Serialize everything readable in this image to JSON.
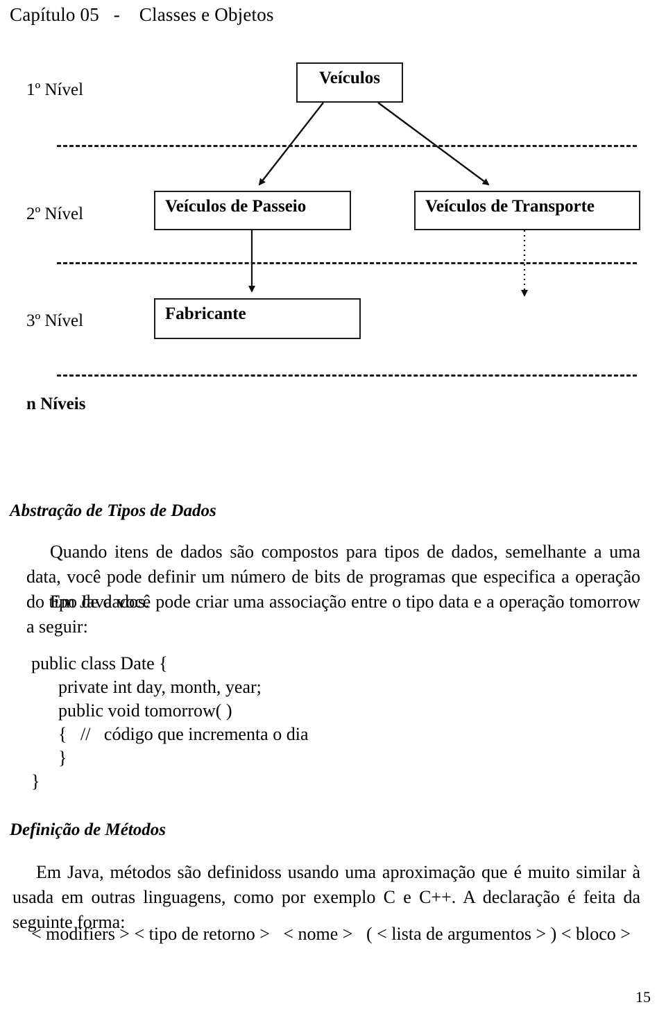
{
  "header": {
    "chapter": "Capítulo 05   -    Classes e Objetos"
  },
  "diagram": {
    "levels": [
      {
        "label": "1º Nível",
        "bold": false
      },
      {
        "label": "2º Nível",
        "bold": false
      },
      {
        "label": "3º Nível",
        "bold": false
      },
      {
        "label": "n Níveis",
        "bold": true
      }
    ],
    "nodes": [
      {
        "label": "Veículos"
      },
      {
        "label": "Veículos de Passeio"
      },
      {
        "label": "Veículos de Transporte"
      },
      {
        "label": "Fabricante"
      }
    ],
    "line_color": "#1a1a1a"
  },
  "sections": [
    {
      "heading": "Abstração de Tipos de Dados",
      "paragraphs": [
        "Quando itens de dados são compostos para tipos de dados, semelhante a uma data, você pode definir um número de bits de programas que especifica a operação do tipo de dados.",
        "Em Java você pode criar uma associação entre o tipo data e a operação tomorrow a seguir:"
      ],
      "code": "public class Date {\n      private int day, month, year;\n      public void tomorrow( )\n      {   //   código que incrementa o dia\n      }\n}"
    },
    {
      "heading": "Definição de Métodos",
      "paragraphs": [
        "Em Java, métodos são definidoss usando uma aproximação que é muito similar à usada em outras linguagens, como por exemplo C e C++. A declaração é feita da seguinte forma:"
      ],
      "declaration": "< modifiers > < tipo de retorno >   < nome >   ( < lista de argumentos > ) < bloco >"
    }
  ],
  "footer": {
    "page_number": "15"
  }
}
